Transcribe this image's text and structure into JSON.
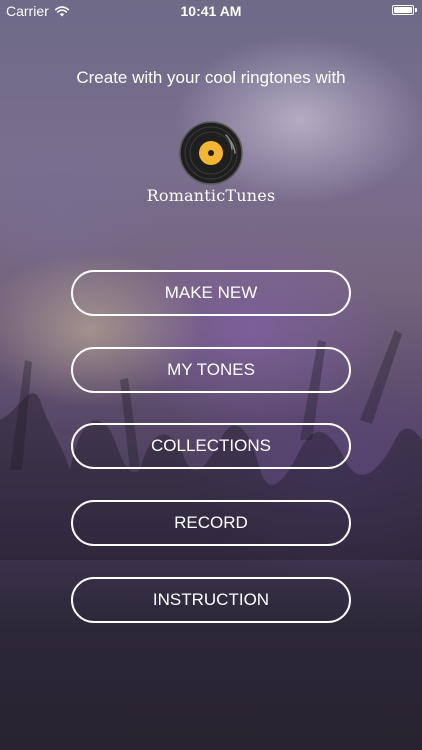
{
  "status_bar": {
    "carrier": "Carrier",
    "time": "10:41 AM",
    "wifi_icon": "wifi-icon",
    "battery_icon": "battery-icon"
  },
  "tagline": "Create with your cool ringtones with",
  "logo": {
    "icon": "vinyl-record-icon",
    "brand_name": "RomanticTunes"
  },
  "menu": {
    "make_new": "MAKE NEW",
    "my_tones": "MY TONES",
    "collections": "COLLECTIONS",
    "record": "RECORD",
    "instruction": "INSTRUCTION"
  },
  "colors": {
    "accent": "#f2b632",
    "button_border": "#ffffff",
    "text": "#ffffff"
  }
}
